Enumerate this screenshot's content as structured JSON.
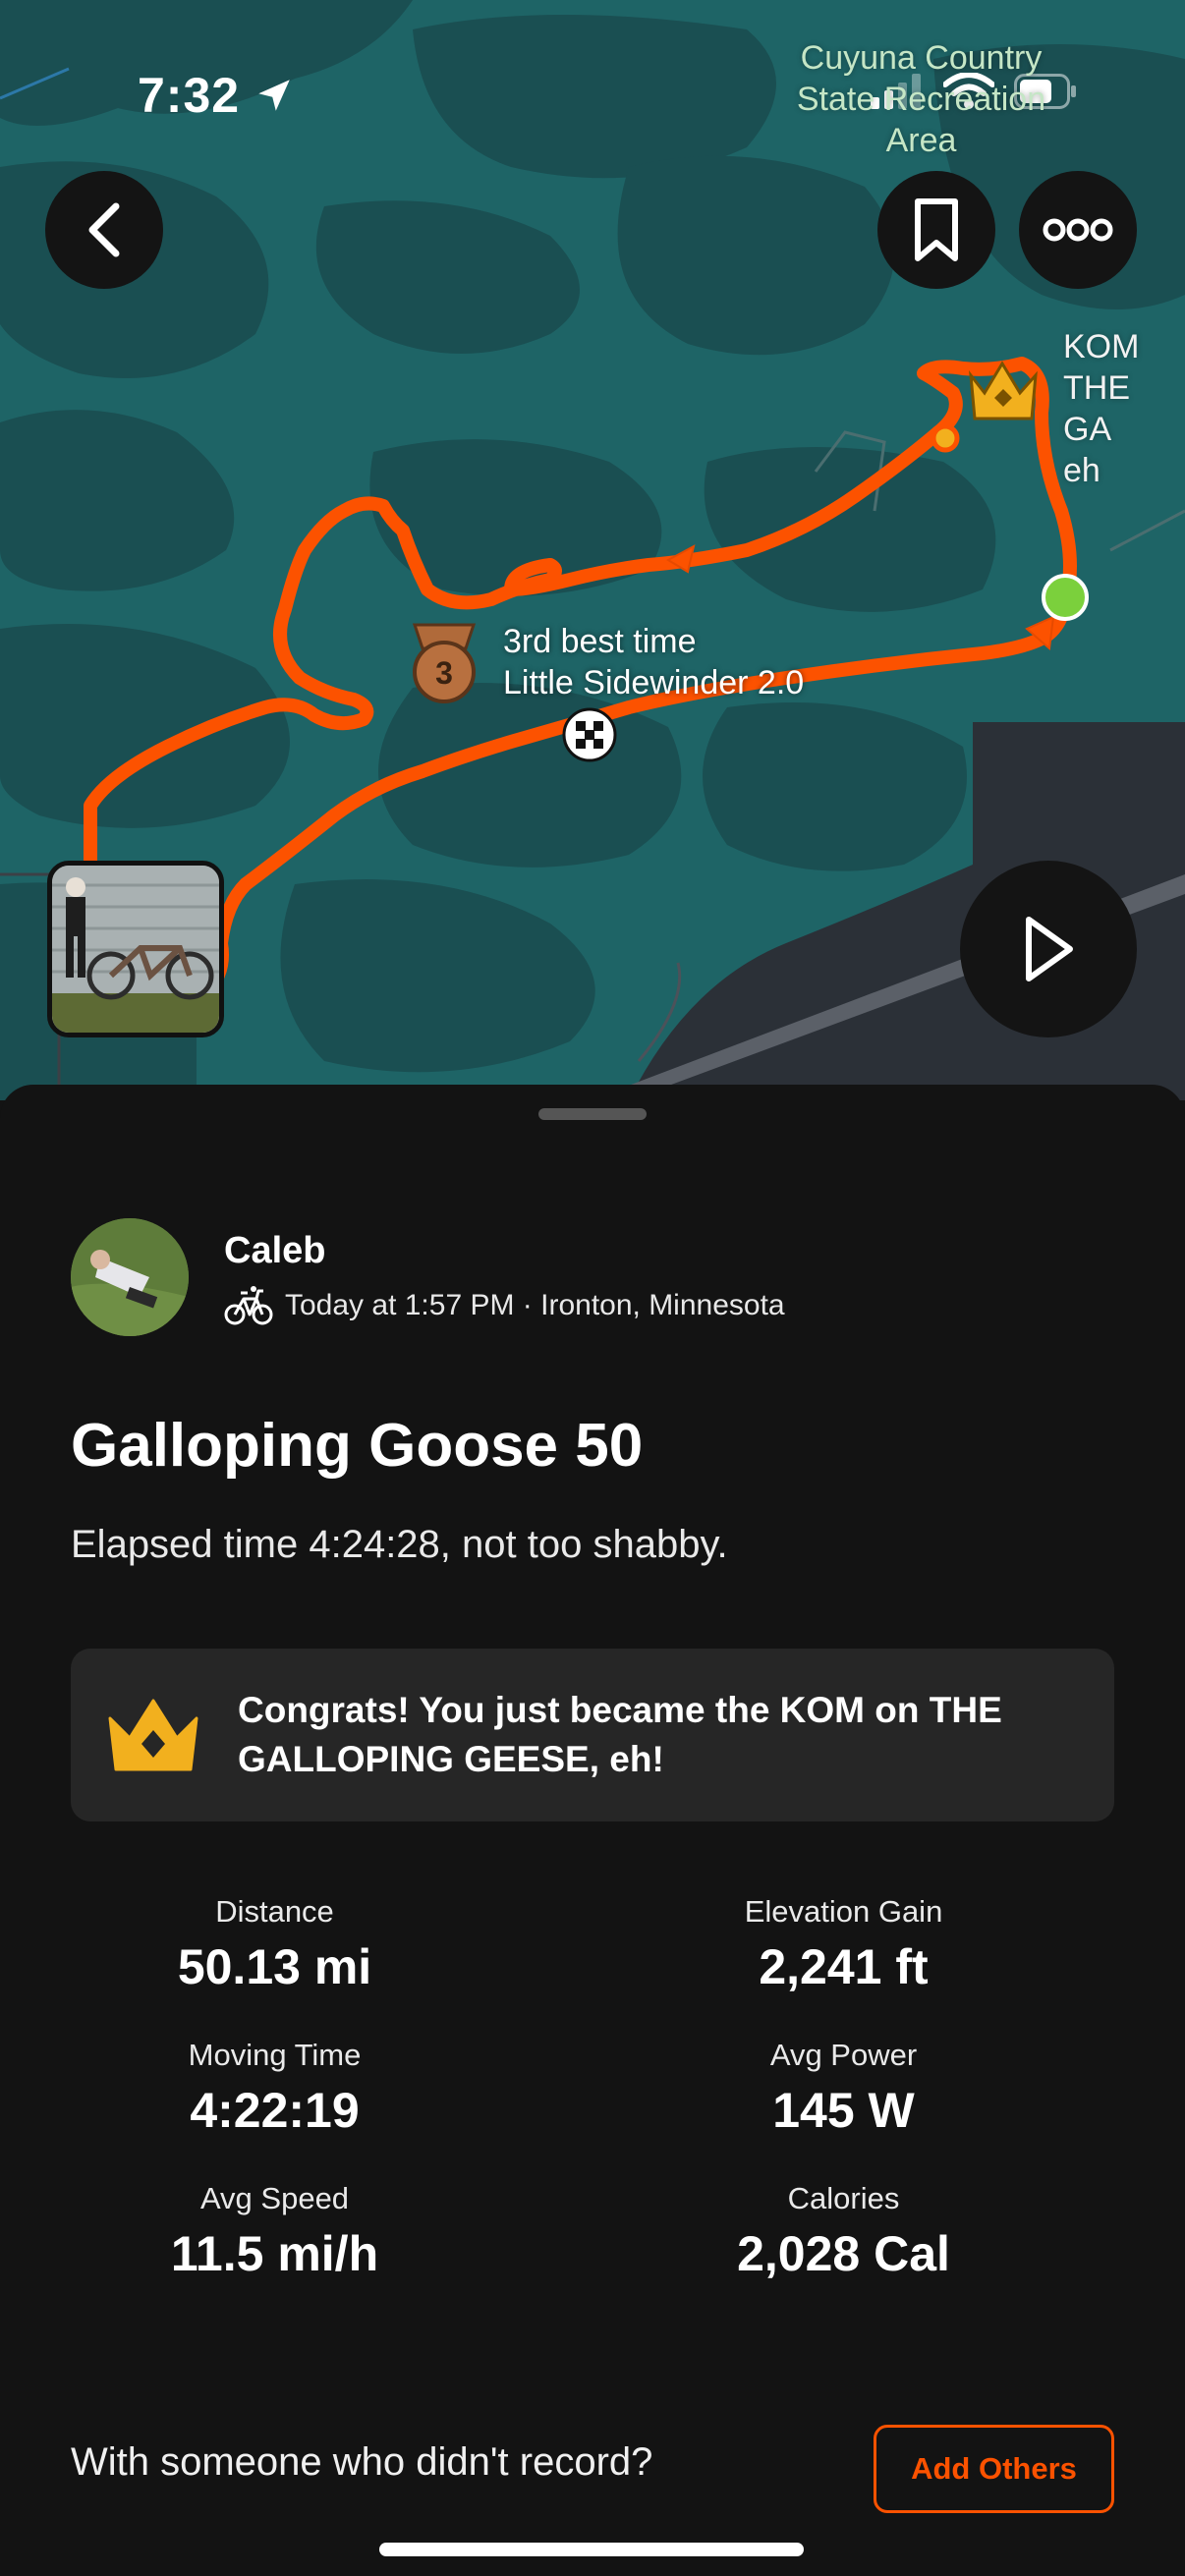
{
  "status_bar": {
    "time": "7:32",
    "location_icon": "location-arrow-icon",
    "signal_icon": "cellular-signal-icon",
    "wifi_icon": "wifi-icon",
    "battery_icon": "battery-icon"
  },
  "map": {
    "area_label": "Cuyuna Country State Recreation Area",
    "kom_label_lines": [
      "KOM",
      "THE GA",
      "eh"
    ],
    "segment_rank": "3rd best time",
    "segment_name": "Little Sidewinder 2.0",
    "segment_medal_rank": "3",
    "route_color": "#fc5200",
    "water_color": "#1b5f61",
    "land_color": "#195052"
  },
  "toolbar": {
    "back_icon": "chevron-left-icon",
    "save_icon": "bookmark-icon",
    "more_icon": "more-dots-icon",
    "play_icon": "play-icon"
  },
  "athlete": {
    "name": "Caleb",
    "activity_icon": "bike-icon",
    "meta": "Today at 1:57 PM · Ironton, Minnesota"
  },
  "activity": {
    "title": "Galloping Goose 50",
    "description": "Elapsed time 4:24:28, not too shabby."
  },
  "achievement": {
    "icon": "crown-icon",
    "text": "Congrats! You just became the KOM on THE GALLOPING GEESE, eh!",
    "color": "#f2b01e"
  },
  "stats": [
    {
      "label": "Distance",
      "value": "50.13 mi"
    },
    {
      "label": "Elevation Gain",
      "value": "2,241 ft"
    },
    {
      "label": "Moving Time",
      "value": "4:22:19"
    },
    {
      "label": "Avg Power",
      "value": "145 W"
    },
    {
      "label": "Avg Speed",
      "value": "11.5 mi/h"
    },
    {
      "label": "Calories",
      "value": "2,028 Cal"
    }
  ],
  "footer": {
    "prompt": "With someone who didn't record?",
    "add_label": "Add Others",
    "accent": "#fc5200"
  }
}
